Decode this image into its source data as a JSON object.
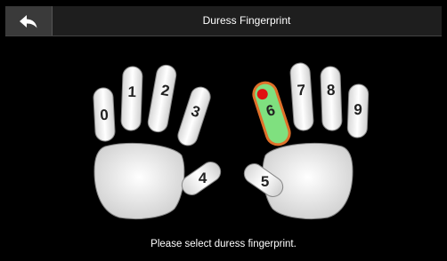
{
  "header": {
    "title": "Duress Fingerprint",
    "back_icon": "back-arrow-icon"
  },
  "fingers": {
    "f0": "0",
    "f1": "1",
    "f2": "2",
    "f3": "3",
    "f4": "4",
    "f5": "5",
    "f6": "6",
    "f7": "7",
    "f8": "8",
    "f9": "9"
  },
  "selected_finger": "6",
  "footer": {
    "prompt": "Please select duress fingerprint."
  },
  "colors": {
    "selected_fill": "#7fe07f",
    "selected_border": "#e0702a",
    "selected_dot": "#e01010",
    "finger_fill": "#f2f2f2"
  }
}
